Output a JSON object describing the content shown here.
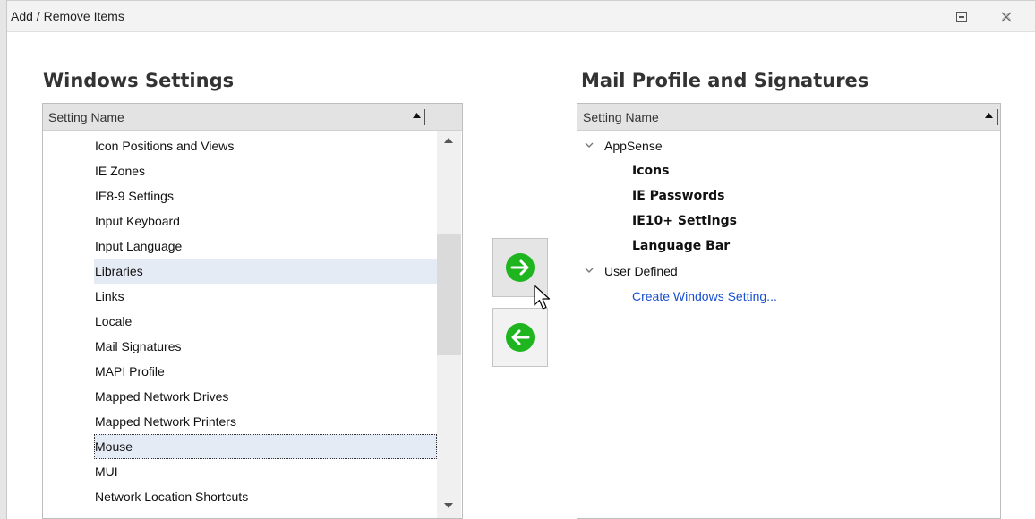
{
  "window": {
    "title": "Add / Remove Items",
    "restore_icon": "restore-icon",
    "close_icon": "close-icon"
  },
  "left_panel": {
    "heading": "Windows Settings",
    "column_header": "Setting Name",
    "items": [
      "Icon Positions and Views",
      "IE Zones",
      "IE8-9 Settings",
      "Input Keyboard",
      "Input Language",
      "Libraries",
      "Links",
      "Locale",
      "Mail Signatures",
      "MAPI Profile",
      "Mapped Network Drives",
      "Mapped Network Printers",
      "Mouse",
      "MUI",
      "Network Location Shortcuts"
    ],
    "highlighted_item": "Libraries",
    "selected_item": "Mouse"
  },
  "move_buttons": {
    "add_icon": "arrow-right-icon",
    "remove_icon": "arrow-left-icon",
    "accent_color": "#1fb51f"
  },
  "right_panel": {
    "heading": "Mail Profile and Signatures",
    "column_header": "Setting Name",
    "tree": [
      {
        "label": "AppSense",
        "children": [
          "Icons",
          "IE Passwords",
          "IE10+ Settings",
          "Language Bar"
        ]
      },
      {
        "label": "User Defined",
        "link": "Create Windows Setting..."
      }
    ]
  }
}
